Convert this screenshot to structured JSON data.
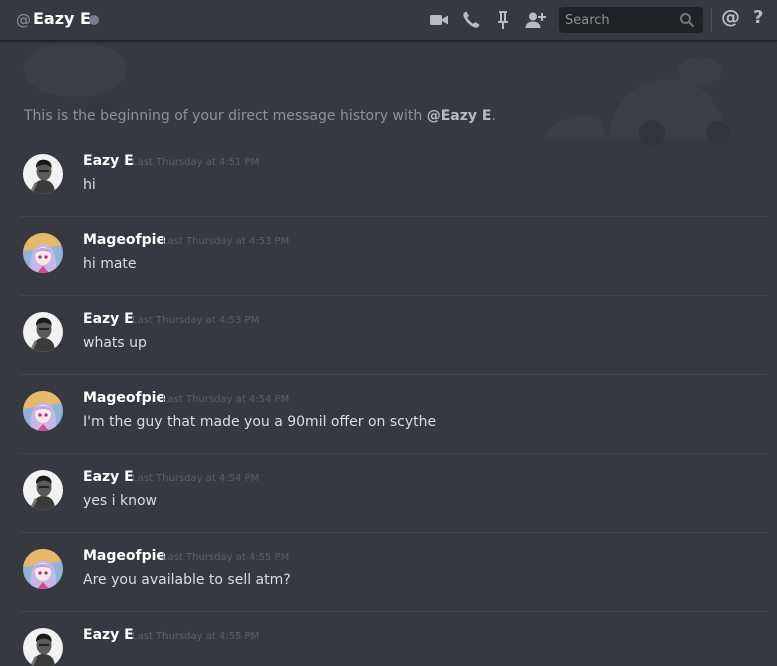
{
  "header": {
    "at_symbol": "@",
    "title": "Eazy E",
    "status": "offline",
    "icons": [
      "video-call-icon",
      "voice-call-icon",
      "pinned-messages-icon",
      "add-friend-icon"
    ],
    "search_placeholder": "Search",
    "mention_label": "@",
    "help_label": "?"
  },
  "welcome": {
    "prefix": "This is the beginning of your direct message history with ",
    "mention": "@Eazy E",
    "suffix": "."
  },
  "messages": [
    {
      "author": "Eazy E",
      "timestamp": "Last Thursday at 4:51 PM",
      "text": "hi",
      "avatar": "eazy-e"
    },
    {
      "author": "Mageofpie",
      "timestamp": "Last Thursday at 4:53 PM",
      "text": "hi mate",
      "avatar": "mageofpie"
    },
    {
      "author": "Eazy E",
      "timestamp": "Last Thursday at 4:53 PM",
      "text": "whats up",
      "avatar": "eazy-e"
    },
    {
      "author": "Mageofpie",
      "timestamp": "Last Thursday at 4:54 PM",
      "text": "I'm the guy that made you a 90mil offer on scythe",
      "avatar": "mageofpie"
    },
    {
      "author": "Eazy E",
      "timestamp": "Last Thursday at 4:54 PM",
      "text": "yes i know",
      "avatar": "eazy-e"
    },
    {
      "author": "Mageofpie",
      "timestamp": "Last Thursday at 4:55 PM",
      "text": "Are you available to sell atm?",
      "avatar": "mageofpie"
    },
    {
      "author": "Eazy E",
      "timestamp": "Last Thursday at 4:55 PM",
      "text": "",
      "avatar": "eazy-e"
    }
  ],
  "colors": {
    "background": "#36393f",
    "header_border": "#202225",
    "text": "#dcddde",
    "muted": "#8e9297",
    "timestamp": "#5d6167",
    "separator": "#42454a",
    "status_offline": "#747f8d"
  }
}
